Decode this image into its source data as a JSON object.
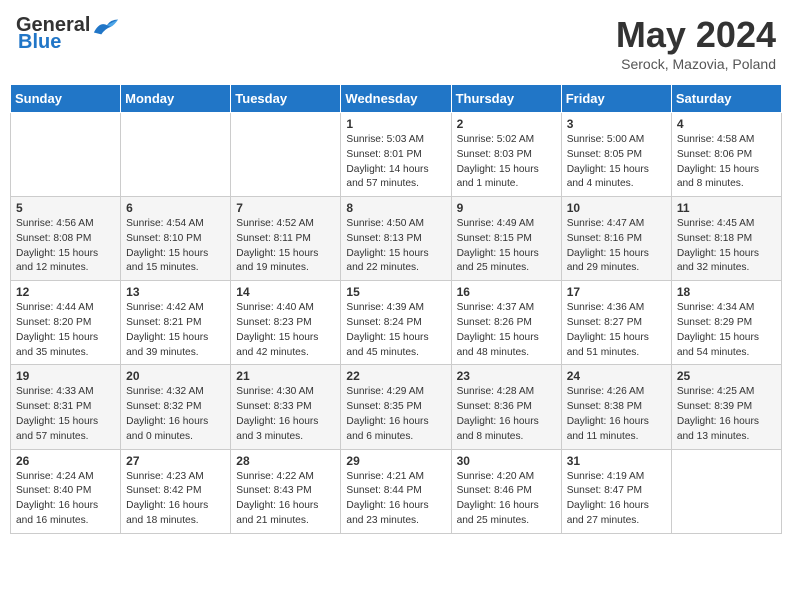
{
  "header": {
    "logo_general": "General",
    "logo_blue": "Blue",
    "month_title": "May 2024",
    "subtitle": "Serock, Mazovia, Poland"
  },
  "days_of_week": [
    "Sunday",
    "Monday",
    "Tuesday",
    "Wednesday",
    "Thursday",
    "Friday",
    "Saturday"
  ],
  "weeks": [
    [
      {
        "day": "",
        "sunrise": "",
        "sunset": "",
        "daylight": ""
      },
      {
        "day": "",
        "sunrise": "",
        "sunset": "",
        "daylight": ""
      },
      {
        "day": "",
        "sunrise": "",
        "sunset": "",
        "daylight": ""
      },
      {
        "day": "1",
        "sunrise": "Sunrise: 5:03 AM",
        "sunset": "Sunset: 8:01 PM",
        "daylight": "Daylight: 14 hours and 57 minutes."
      },
      {
        "day": "2",
        "sunrise": "Sunrise: 5:02 AM",
        "sunset": "Sunset: 8:03 PM",
        "daylight": "Daylight: 15 hours and 1 minute."
      },
      {
        "day": "3",
        "sunrise": "Sunrise: 5:00 AM",
        "sunset": "Sunset: 8:05 PM",
        "daylight": "Daylight: 15 hours and 4 minutes."
      },
      {
        "day": "4",
        "sunrise": "Sunrise: 4:58 AM",
        "sunset": "Sunset: 8:06 PM",
        "daylight": "Daylight: 15 hours and 8 minutes."
      }
    ],
    [
      {
        "day": "5",
        "sunrise": "Sunrise: 4:56 AM",
        "sunset": "Sunset: 8:08 PM",
        "daylight": "Daylight: 15 hours and 12 minutes."
      },
      {
        "day": "6",
        "sunrise": "Sunrise: 4:54 AM",
        "sunset": "Sunset: 8:10 PM",
        "daylight": "Daylight: 15 hours and 15 minutes."
      },
      {
        "day": "7",
        "sunrise": "Sunrise: 4:52 AM",
        "sunset": "Sunset: 8:11 PM",
        "daylight": "Daylight: 15 hours and 19 minutes."
      },
      {
        "day": "8",
        "sunrise": "Sunrise: 4:50 AM",
        "sunset": "Sunset: 8:13 PM",
        "daylight": "Daylight: 15 hours and 22 minutes."
      },
      {
        "day": "9",
        "sunrise": "Sunrise: 4:49 AM",
        "sunset": "Sunset: 8:15 PM",
        "daylight": "Daylight: 15 hours and 25 minutes."
      },
      {
        "day": "10",
        "sunrise": "Sunrise: 4:47 AM",
        "sunset": "Sunset: 8:16 PM",
        "daylight": "Daylight: 15 hours and 29 minutes."
      },
      {
        "day": "11",
        "sunrise": "Sunrise: 4:45 AM",
        "sunset": "Sunset: 8:18 PM",
        "daylight": "Daylight: 15 hours and 32 minutes."
      }
    ],
    [
      {
        "day": "12",
        "sunrise": "Sunrise: 4:44 AM",
        "sunset": "Sunset: 8:20 PM",
        "daylight": "Daylight: 15 hours and 35 minutes."
      },
      {
        "day": "13",
        "sunrise": "Sunrise: 4:42 AM",
        "sunset": "Sunset: 8:21 PM",
        "daylight": "Daylight: 15 hours and 39 minutes."
      },
      {
        "day": "14",
        "sunrise": "Sunrise: 4:40 AM",
        "sunset": "Sunset: 8:23 PM",
        "daylight": "Daylight: 15 hours and 42 minutes."
      },
      {
        "day": "15",
        "sunrise": "Sunrise: 4:39 AM",
        "sunset": "Sunset: 8:24 PM",
        "daylight": "Daylight: 15 hours and 45 minutes."
      },
      {
        "day": "16",
        "sunrise": "Sunrise: 4:37 AM",
        "sunset": "Sunset: 8:26 PM",
        "daylight": "Daylight: 15 hours and 48 minutes."
      },
      {
        "day": "17",
        "sunrise": "Sunrise: 4:36 AM",
        "sunset": "Sunset: 8:27 PM",
        "daylight": "Daylight: 15 hours and 51 minutes."
      },
      {
        "day": "18",
        "sunrise": "Sunrise: 4:34 AM",
        "sunset": "Sunset: 8:29 PM",
        "daylight": "Daylight: 15 hours and 54 minutes."
      }
    ],
    [
      {
        "day": "19",
        "sunrise": "Sunrise: 4:33 AM",
        "sunset": "Sunset: 8:31 PM",
        "daylight": "Daylight: 15 hours and 57 minutes."
      },
      {
        "day": "20",
        "sunrise": "Sunrise: 4:32 AM",
        "sunset": "Sunset: 8:32 PM",
        "daylight": "Daylight: 16 hours and 0 minutes."
      },
      {
        "day": "21",
        "sunrise": "Sunrise: 4:30 AM",
        "sunset": "Sunset: 8:33 PM",
        "daylight": "Daylight: 16 hours and 3 minutes."
      },
      {
        "day": "22",
        "sunrise": "Sunrise: 4:29 AM",
        "sunset": "Sunset: 8:35 PM",
        "daylight": "Daylight: 16 hours and 6 minutes."
      },
      {
        "day": "23",
        "sunrise": "Sunrise: 4:28 AM",
        "sunset": "Sunset: 8:36 PM",
        "daylight": "Daylight: 16 hours and 8 minutes."
      },
      {
        "day": "24",
        "sunrise": "Sunrise: 4:26 AM",
        "sunset": "Sunset: 8:38 PM",
        "daylight": "Daylight: 16 hours and 11 minutes."
      },
      {
        "day": "25",
        "sunrise": "Sunrise: 4:25 AM",
        "sunset": "Sunset: 8:39 PM",
        "daylight": "Daylight: 16 hours and 13 minutes."
      }
    ],
    [
      {
        "day": "26",
        "sunrise": "Sunrise: 4:24 AM",
        "sunset": "Sunset: 8:40 PM",
        "daylight": "Daylight: 16 hours and 16 minutes."
      },
      {
        "day": "27",
        "sunrise": "Sunrise: 4:23 AM",
        "sunset": "Sunset: 8:42 PM",
        "daylight": "Daylight: 16 hours and 18 minutes."
      },
      {
        "day": "28",
        "sunrise": "Sunrise: 4:22 AM",
        "sunset": "Sunset: 8:43 PM",
        "daylight": "Daylight: 16 hours and 21 minutes."
      },
      {
        "day": "29",
        "sunrise": "Sunrise: 4:21 AM",
        "sunset": "Sunset: 8:44 PM",
        "daylight": "Daylight: 16 hours and 23 minutes."
      },
      {
        "day": "30",
        "sunrise": "Sunrise: 4:20 AM",
        "sunset": "Sunset: 8:46 PM",
        "daylight": "Daylight: 16 hours and 25 minutes."
      },
      {
        "day": "31",
        "sunrise": "Sunrise: 4:19 AM",
        "sunset": "Sunset: 8:47 PM",
        "daylight": "Daylight: 16 hours and 27 minutes."
      },
      {
        "day": "",
        "sunrise": "",
        "sunset": "",
        "daylight": ""
      }
    ]
  ]
}
